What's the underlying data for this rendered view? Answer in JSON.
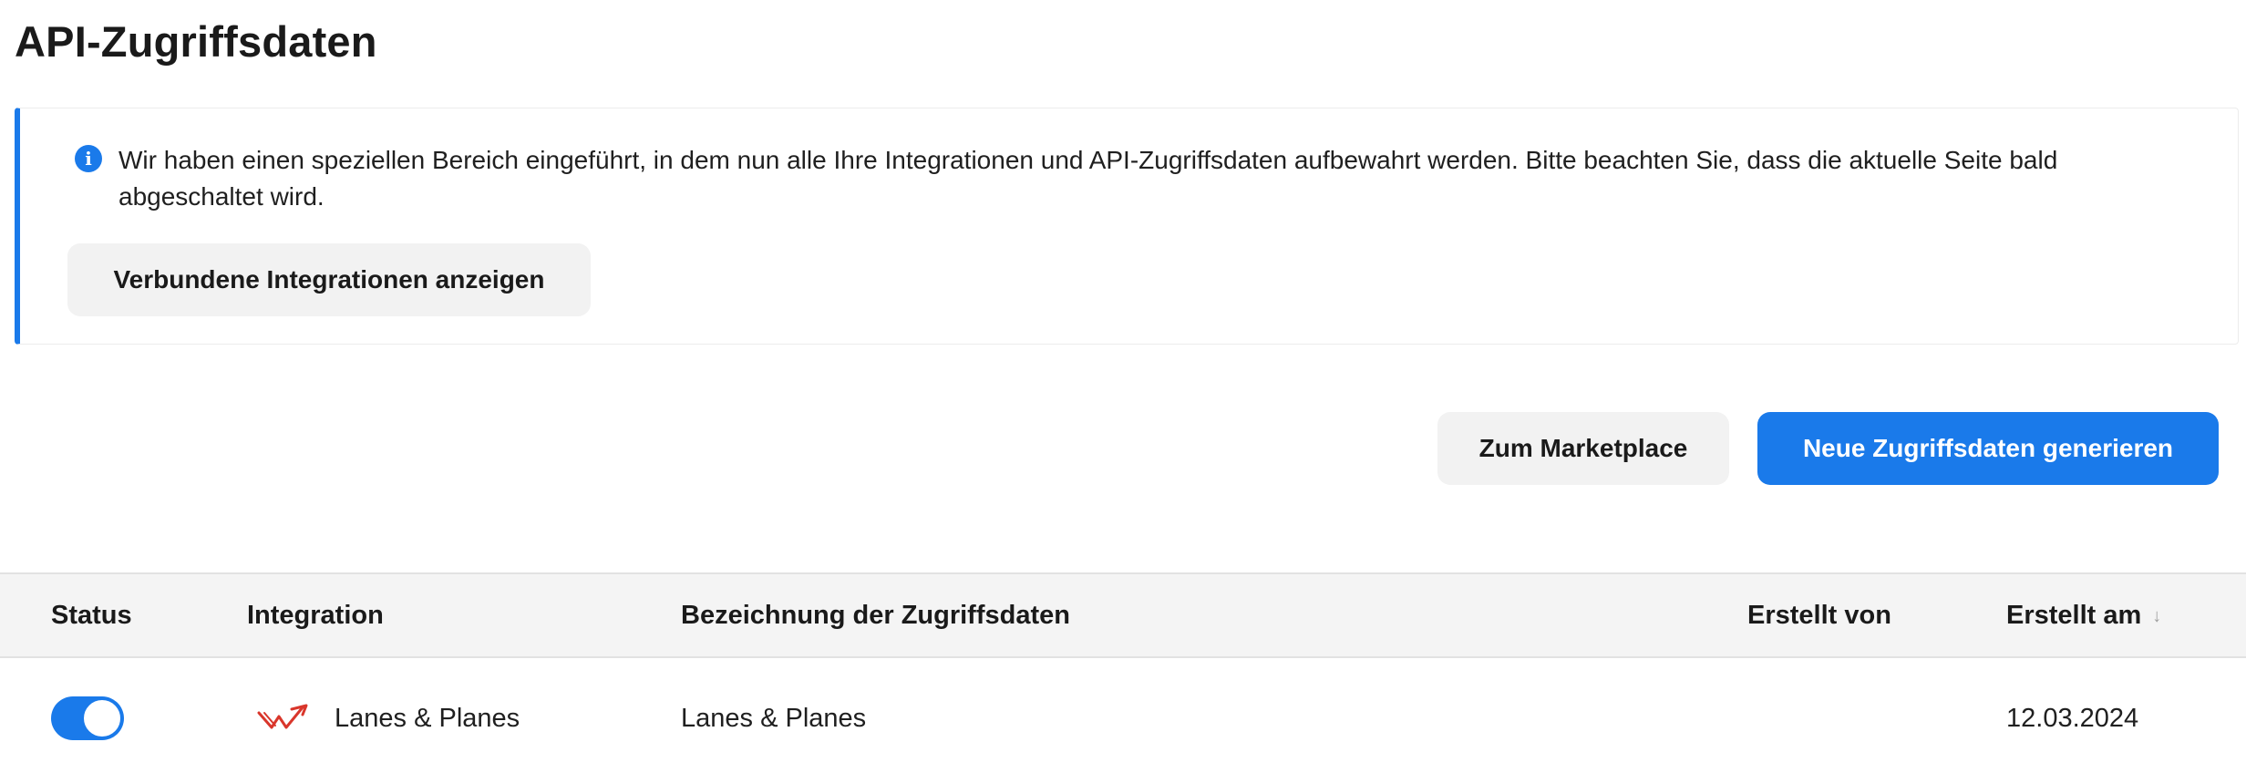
{
  "page": {
    "title": "API-Zugriffsdaten"
  },
  "notice": {
    "icon": "info-icon",
    "text": "Wir haben einen speziellen Bereich eingeführt, in dem nun alle Ihre Integrationen und API-Zugriffsdaten aufbewahrt werden. Bitte beachten Sie, dass die aktuelle Seite bald abgeschaltet wird.",
    "button_label": "Verbundene Integrationen anzeigen",
    "accent_color": "#1a7aea"
  },
  "actions": {
    "marketplace_label": "Zum Marketplace",
    "generate_label": "Neue Zugriffsdaten generieren",
    "primary_color": "#1a7aea"
  },
  "table": {
    "columns": [
      {
        "label": "Status"
      },
      {
        "label": "Integration"
      },
      {
        "label": "Bezeichnung der Zugriffsdaten"
      },
      {
        "label": "Erstellt von"
      },
      {
        "label": "Erstellt am",
        "sort": "descending",
        "sort_icon": "arrow-down-icon"
      }
    ],
    "rows": [
      {
        "status_enabled": true,
        "integration_icon": "lanes-planes-logo",
        "integration": "Lanes & Planes",
        "name": "Lanes & Planes",
        "created_by": "",
        "created_at": "12.03.2024"
      }
    ]
  }
}
